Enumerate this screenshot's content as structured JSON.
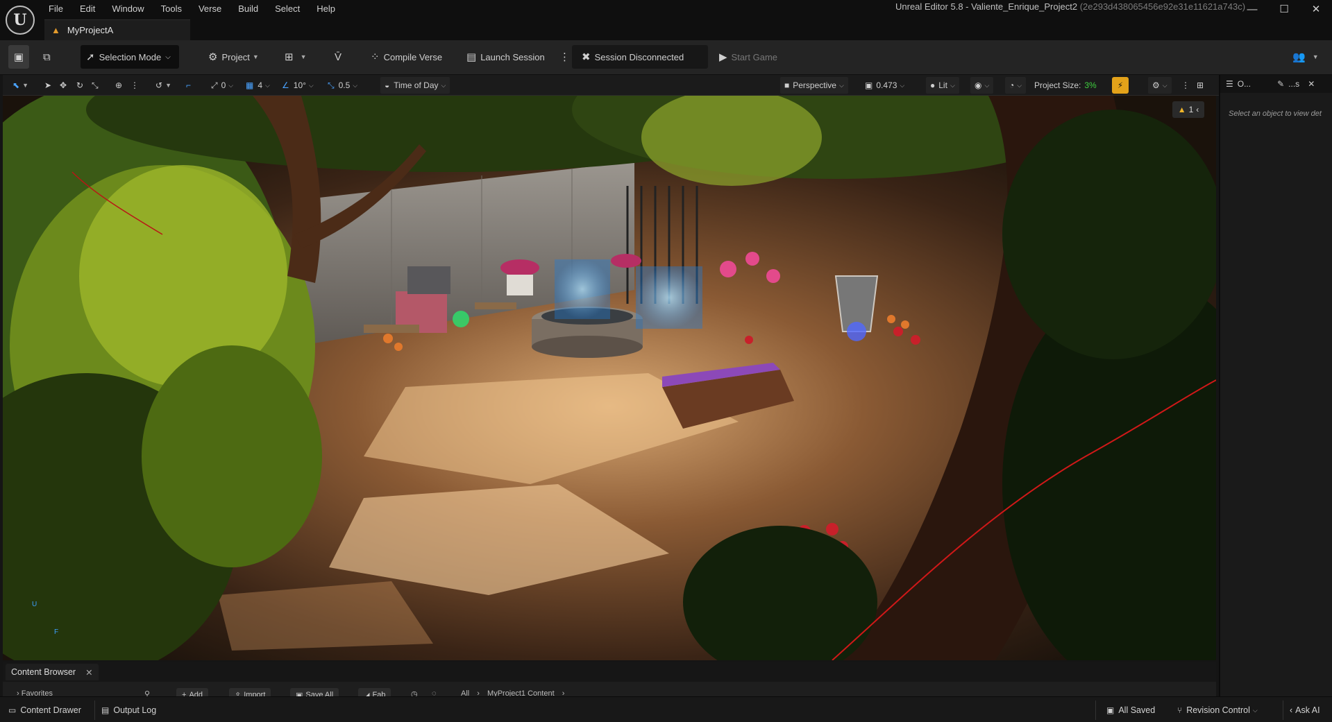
{
  "app": {
    "logo": "unreal-logo",
    "window_title": "Unreal Editor 5.8 - Valiente_Enrique_Project2",
    "window_hash": "(2e293d438065456e92e31e11621a743c)",
    "project_tab": "MyProjectA"
  },
  "menu": [
    "File",
    "Edit",
    "Window",
    "Tools",
    "Verse",
    "Build",
    "Select",
    "Help"
  ],
  "toolbar": {
    "selection_mode": "Selection Mode",
    "project": "Project",
    "compile_verse": "Compile Verse",
    "launch_session": "Launch Session",
    "session_status": "Session Disconnected",
    "start_game": "Start Game"
  },
  "viewport_toolbar": {
    "rotation_snap": "0",
    "grid_snap": "4",
    "angle_snap": "10°",
    "scale_snap": "0.5",
    "time_of_day": "Time of Day",
    "perspective": "Perspective",
    "camera_speed": "0.473",
    "view_mode": "Lit",
    "project_size_label": "Project Size:",
    "project_size_value": "3%"
  },
  "viewport": {
    "warning_count": "1",
    "axis_up": "U",
    "axis_forward": "F"
  },
  "right_panel": {
    "tab_outliner": "O...",
    "tab_details": "...s",
    "hint": "Select an object to view det"
  },
  "content_browser": {
    "tab_label": "Content Browser",
    "favorites": "Favorites",
    "add": "Add",
    "import": "Import",
    "save_all": "Save All",
    "fab": "Fab",
    "path_all": "All",
    "path_folder": "MyProject1 Content"
  },
  "statusbar": {
    "content_drawer": "Content Drawer",
    "output_log": "Output Log",
    "all_saved": "All Saved",
    "revision_control": "Revision Control",
    "ask_ai": "Ask AI"
  },
  "colors": {
    "accent_blue": "#4aa3ff",
    "project_size_green": "#3fd13f",
    "warning_yellow": "#f0b52a",
    "ue_orange": "#e49b2c"
  }
}
